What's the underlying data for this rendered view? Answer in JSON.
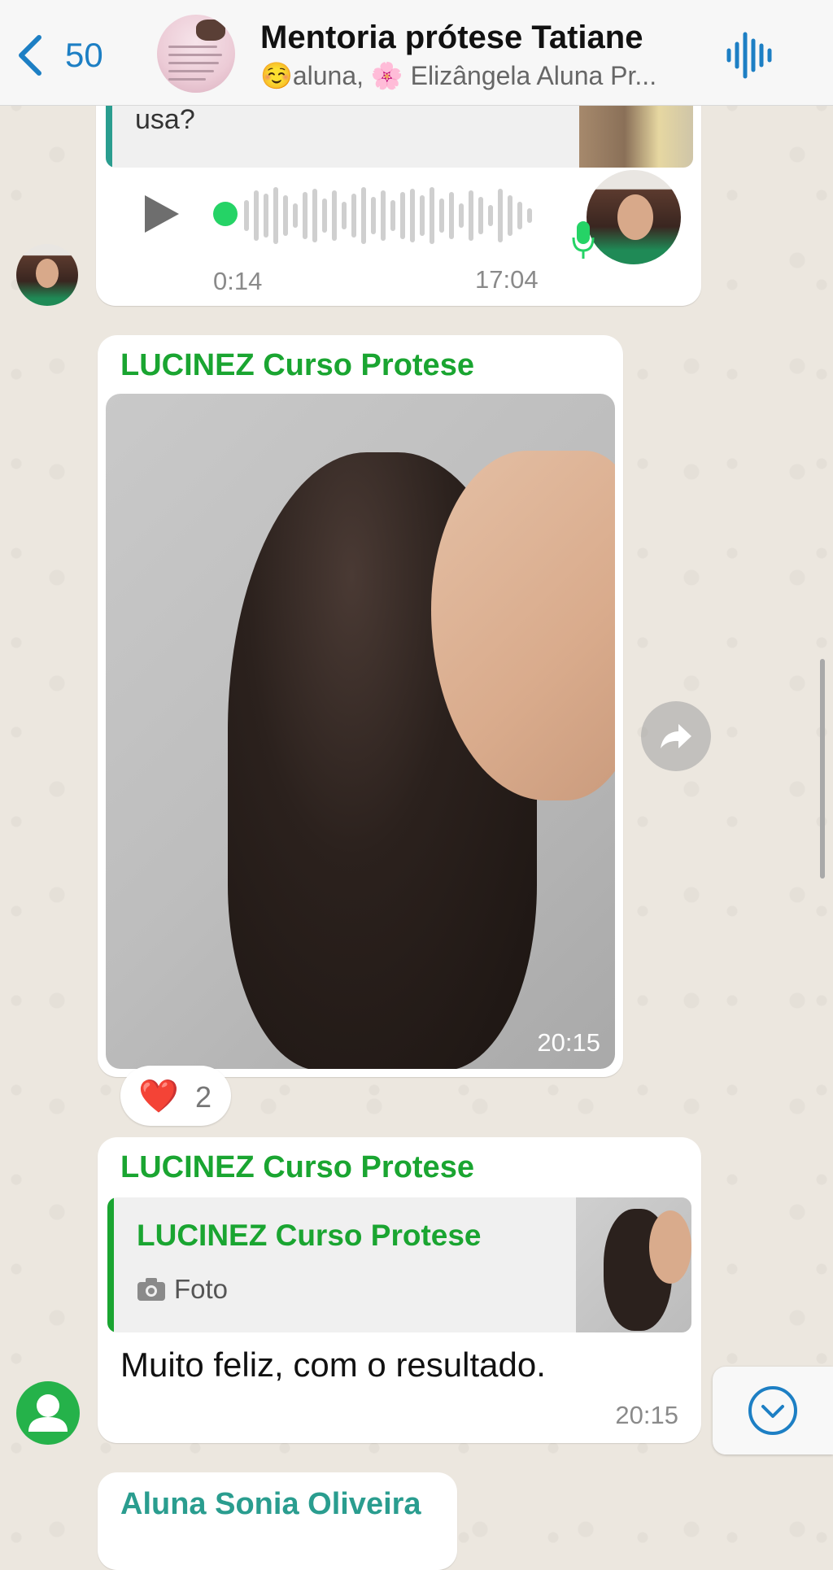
{
  "header": {
    "back_count": "50",
    "title": "Mentoria prótese Tatiane",
    "subtitle": "☺️aluna, 🌸 Elizângela Aluna Pr..."
  },
  "messages": {
    "partial_question": "usa?",
    "audio": {
      "duration": "0:14",
      "time": "17:04"
    },
    "photo_message": {
      "sender": "LUCINEZ Curso Protese",
      "time": "20:15"
    },
    "reaction": {
      "emoji": "❤️",
      "count": "2"
    },
    "reply_message": {
      "sender": "LUCINEZ Curso Protese",
      "quoted_sender": "LUCINEZ Curso Protese",
      "quoted_type": "Foto",
      "text": "Muito feliz, com o resultado.",
      "time": "20:15"
    },
    "next_message": {
      "sender": "Aluna Sonia Oliveira"
    }
  },
  "colors": {
    "accent_blue": "#1d7fc4",
    "sender_green": "#1aa531",
    "sender_teal": "#2a9d8f",
    "mic_green": "#25d366"
  },
  "icons": [
    "chevron-left-icon",
    "voice-wave-icon",
    "play-icon",
    "mic-icon",
    "camera-icon",
    "forward-icon",
    "chevron-down-icon",
    "heart-icon"
  ]
}
